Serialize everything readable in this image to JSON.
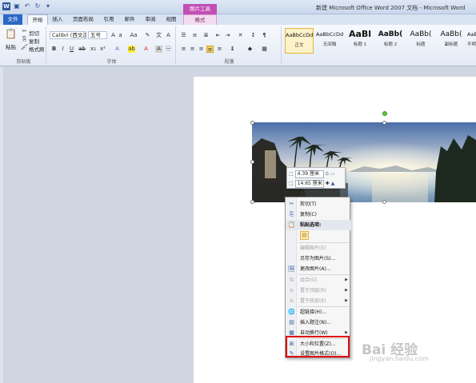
{
  "app": {
    "title": "新建 Microsoft Office Word 2007 文档 - Microsoft Word",
    "contextual_group": "图片工具"
  },
  "tabs": [
    {
      "label": "文件"
    },
    {
      "label": "开始"
    },
    {
      "label": "插入"
    },
    {
      "label": "页面布局"
    },
    {
      "label": "引用"
    },
    {
      "label": "邮件"
    },
    {
      "label": "审阅"
    },
    {
      "label": "视图"
    },
    {
      "label": "格式"
    }
  ],
  "ribbon": {
    "clipboard": {
      "paste": "粘贴",
      "cut": "剪切",
      "copy": "复制",
      "format_painter": "格式刷",
      "group": "剪贴板"
    },
    "font": {
      "name": "Calibri (西文正",
      "size": "五号",
      "group": "字体"
    },
    "paragraph": {
      "group": "段落"
    },
    "styles": [
      {
        "sample": "AaBbCcDd",
        "name": "正文"
      },
      {
        "sample": "AaBbCcDd",
        "name": "无间隔"
      },
      {
        "sample": "AaBl",
        "name": "标题 1"
      },
      {
        "sample": "AaBb(",
        "name": "标题 2"
      },
      {
        "sample": "AaBb(",
        "name": "标题"
      },
      {
        "sample": "AaBb(",
        "name": "副标题"
      },
      {
        "sample": "AaBbCcDd",
        "name": "不明显"
      }
    ]
  },
  "mini_toolbar": {
    "height_value": "4.39 厘米",
    "width_value": "14.65 厘米"
  },
  "context_menu": {
    "items": [
      {
        "label": "剪切(T)",
        "icon": "scissors-icon",
        "disabled": false
      },
      {
        "label": "复制(C)",
        "icon": "copy-icon",
        "disabled": false
      },
      {
        "label": "粘贴选项:",
        "icon": "paste-icon",
        "header": true
      },
      {
        "label": "编辑图片(E)",
        "disabled": true
      },
      {
        "label": "另存为图片(S)...",
        "disabled": false
      },
      {
        "label": "更改图片(A)...",
        "icon": "change-picture-icon",
        "disabled": false
      },
      {
        "label": "组合(G)",
        "icon": "group-icon",
        "disabled": true,
        "submenu": true
      },
      {
        "label": "置于顶层(R)",
        "icon": "bring-front-icon",
        "disabled": true,
        "submenu": true
      },
      {
        "label": "置于底层(K)",
        "icon": "send-back-icon",
        "disabled": true,
        "submenu": true
      },
      {
        "label": "超链接(H)...",
        "icon": "hyperlink-icon",
        "disabled": false
      },
      {
        "label": "插入题注(N)...",
        "icon": "caption-icon",
        "disabled": false
      },
      {
        "label": "自动换行(W)",
        "icon": "wrap-icon",
        "disabled": false,
        "submenu": true
      },
      {
        "label": "大小和位置(Z)...",
        "icon": "size-position-icon",
        "disabled": false
      },
      {
        "label": "设置图片格式(O)...",
        "icon": "format-picture-icon",
        "disabled": false
      }
    ]
  },
  "colors": {
    "highlight_box": "#e01010",
    "file_tab": "#2b67c4",
    "contextual_tab": "#c24fb6"
  },
  "watermark": {
    "brand": "Bai 经验",
    "url": "jingyan.baidu.com"
  }
}
